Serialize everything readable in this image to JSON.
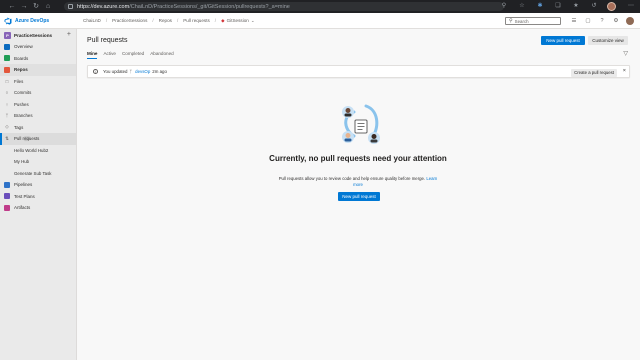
{
  "browser": {
    "url_host": "https://dev.azure.com",
    "url_path": "/ChaiLnD/PracticeSessions/_git/GitSession/pullrequests?_a=mine"
  },
  "app": {
    "brand": "Azure DevOps",
    "breadcrumbs": {
      "org": "ChaiLnD",
      "project": "PracticeSessions",
      "repos": "Repos",
      "pull_requests": "Pull requests",
      "repo": "GitSession"
    },
    "search_placeholder": "Search"
  },
  "sidebar": {
    "project_name": "PracticeSessions",
    "project_initial": "P",
    "overview": "Overview",
    "boards": "Boards",
    "repos": "Repos",
    "repos_items": {
      "files": "Files",
      "commits": "Commits",
      "pushes": "Pushes",
      "branches": "Branches",
      "tags": "Tags",
      "pull_requests": "Pull requests"
    },
    "extra_items": {
      "hello_world": "Hello World Hub2",
      "my_hub": "My Hub",
      "generate_sub_task": "Generate Sub Task"
    },
    "pipelines": "Pipelines",
    "test_plans": "Test Plans",
    "artifacts": "Artifacts"
  },
  "main": {
    "title": "Pull requests",
    "new_pr_button": "New pull request",
    "customize_button": "Customize view",
    "tabs": {
      "mine": "Mine",
      "active": "Active",
      "completed": "Completed",
      "abandoned": "Abandoned"
    },
    "notice": {
      "prefix": "You updated",
      "branch": "devsOp",
      "time": "2m ago",
      "create_button": "Create a pull request"
    },
    "empty": {
      "title": "Currently, no pull requests need your attention",
      "desc_start": "Pull requests allow you to review code and help ensure quality before merge.",
      "learn_more": "Learn more",
      "button": "New pull request"
    }
  },
  "colors": {
    "accent": "#0078d4",
    "repos_icon": "#e3573c",
    "boards_icon": "#1f9d55",
    "pipelines_icon": "#2f73c8",
    "test_plans_icon": "#6b4fbb",
    "artifacts_icon": "#c03c8a"
  }
}
